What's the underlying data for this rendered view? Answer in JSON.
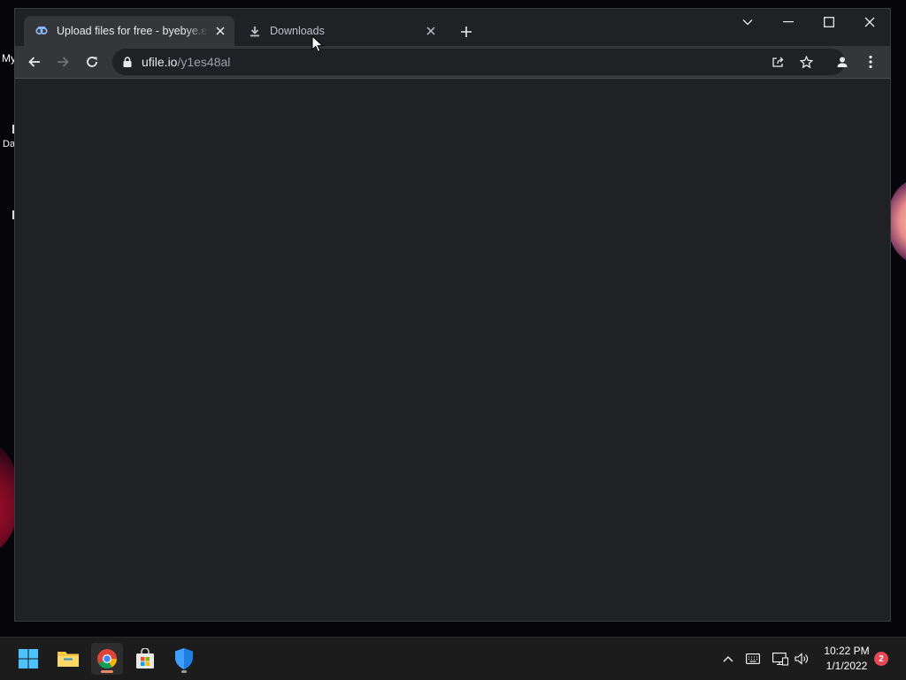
{
  "desktop": {
    "labels": [
      "My",
      "Da"
    ]
  },
  "browser": {
    "tabs": [
      {
        "title": "Upload files for free - byebye.exe",
        "active": true,
        "icon": "ufile-favicon"
      },
      {
        "title": "Downloads",
        "active": false,
        "icon": "download-icon"
      }
    ],
    "address": {
      "host": "ufile.io",
      "path": "/y1es48al"
    }
  },
  "taskbar": {
    "apps": [
      {
        "name": "start",
        "icon": "windows-start-icon"
      },
      {
        "name": "file-explorer",
        "icon": "folder-icon"
      },
      {
        "name": "chrome",
        "icon": "chrome-icon",
        "active": true
      },
      {
        "name": "microsoft-store",
        "icon": "store-icon"
      },
      {
        "name": "windows-security",
        "icon": "shield-icon"
      }
    ],
    "clock": {
      "time": "10:22 PM",
      "date": "1/1/2022"
    },
    "notification_count": "2"
  },
  "colors": {
    "window_bg": "#202124",
    "toolbar_bg": "#35363a",
    "taskbar_bg": "#1c1c1c",
    "accent": "#8ab4f8"
  }
}
